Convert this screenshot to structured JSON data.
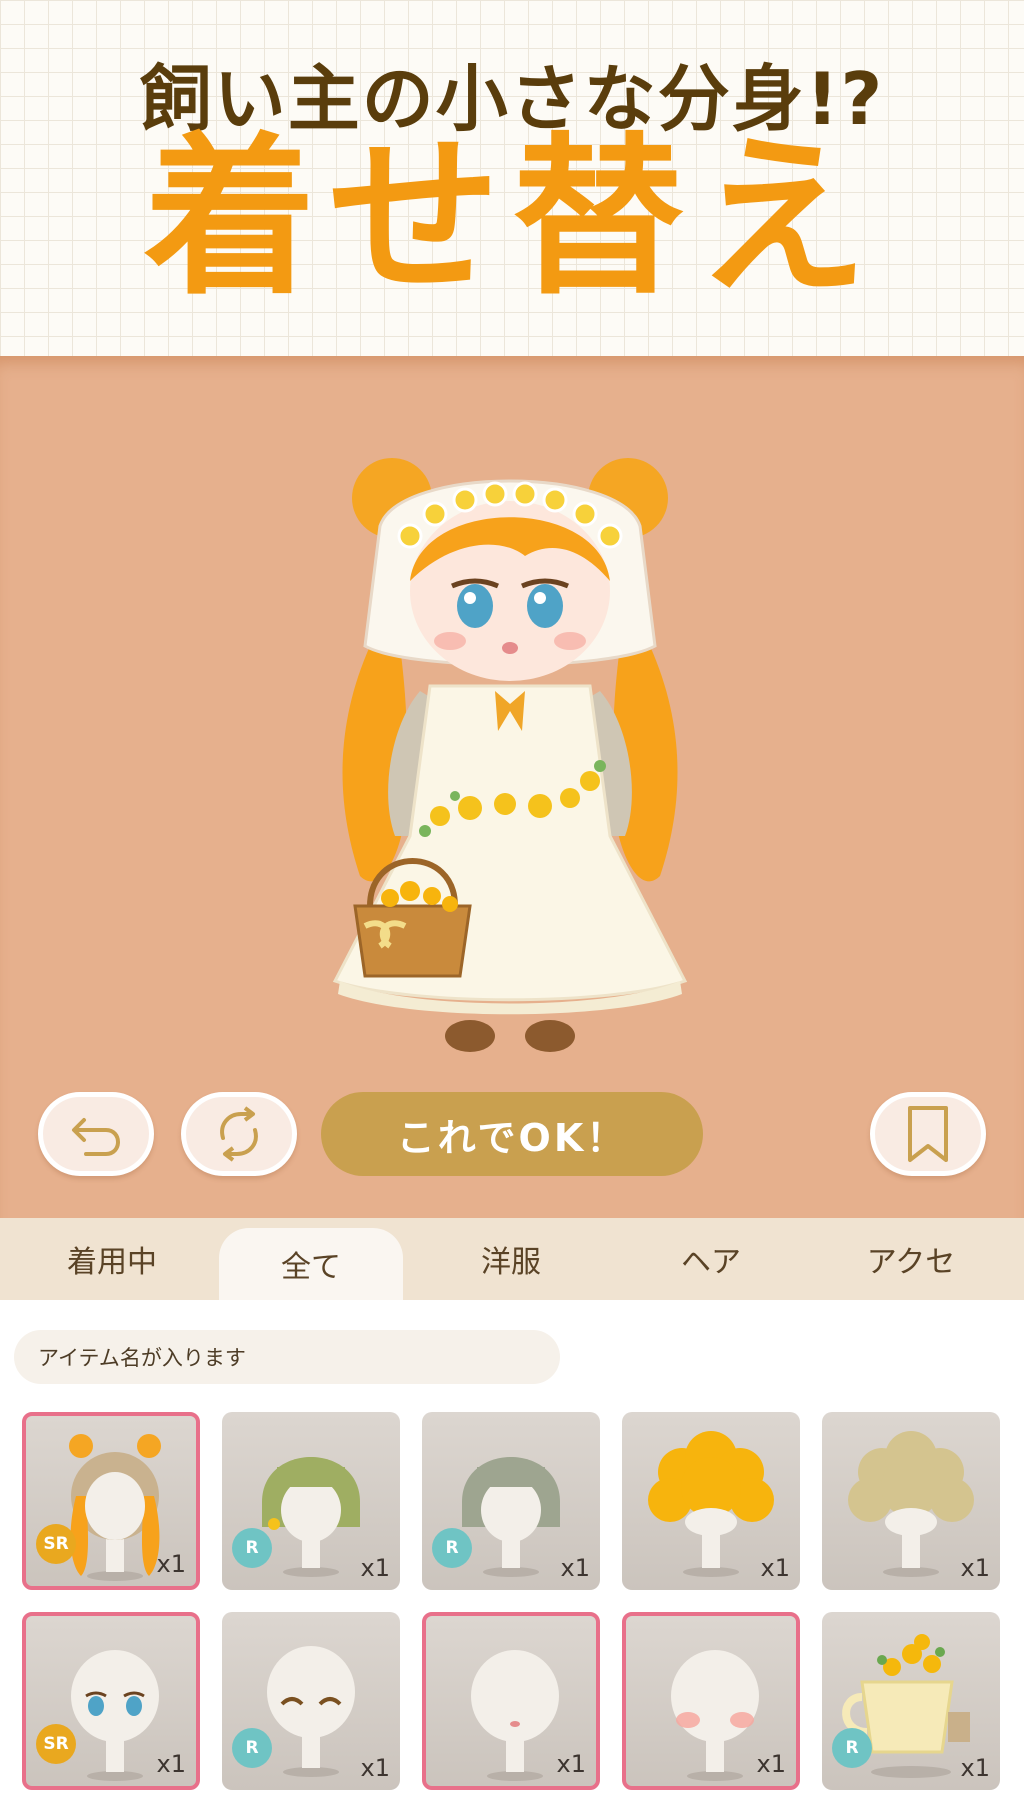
{
  "header": {
    "subtitle": "飼い主の小さな分身!?",
    "title": "着せ替え"
  },
  "controls": {
    "undo_icon": "undo-icon",
    "random_icon": "shuffle-icon",
    "ok_label": "これでOK！",
    "bookmark_icon": "bookmark-icon"
  },
  "tabs": [
    {
      "label": "着用中"
    },
    {
      "label": "全て"
    },
    {
      "label": "洋服"
    },
    {
      "label": "ヘア"
    },
    {
      "label": "アクセ"
    }
  ],
  "active_tab": "全て",
  "search": {
    "placeholder": "アイテム名が入ります"
  },
  "items": [
    {
      "kind": "hair-twin-tails",
      "rarity": "SR",
      "count": "x1",
      "selected": true
    },
    {
      "kind": "hair-green-bob-flower",
      "rarity": "R",
      "count": "x1",
      "selected": false
    },
    {
      "kind": "hair-gray-bob",
      "rarity": "R",
      "count": "x1",
      "selected": false
    },
    {
      "kind": "hair-yellow-afro",
      "rarity": "",
      "count": "x1",
      "selected": false
    },
    {
      "kind": "hair-beige-afro",
      "rarity": "",
      "count": "x1",
      "selected": false
    },
    {
      "kind": "face-blue-eyes",
      "rarity": "SR",
      "count": "x1",
      "selected": true
    },
    {
      "kind": "face-closed-eyes",
      "rarity": "R",
      "count": "x1",
      "selected": false
    },
    {
      "kind": "face-mouth",
      "rarity": "",
      "count": "x1",
      "selected": true
    },
    {
      "kind": "face-blush",
      "rarity": "",
      "count": "x1",
      "selected": true
    },
    {
      "kind": "acc-flower-teacup",
      "rarity": "R",
      "count": "x1",
      "selected": false
    }
  ],
  "colors": {
    "accent_orange": "#f39a12",
    "stage_bg": "#e6b08d",
    "ok_button": "#c9a04f",
    "selected_border": "#e8708a",
    "rarity_sr": "#e9a81f",
    "rarity_r": "#6fc4c4"
  }
}
